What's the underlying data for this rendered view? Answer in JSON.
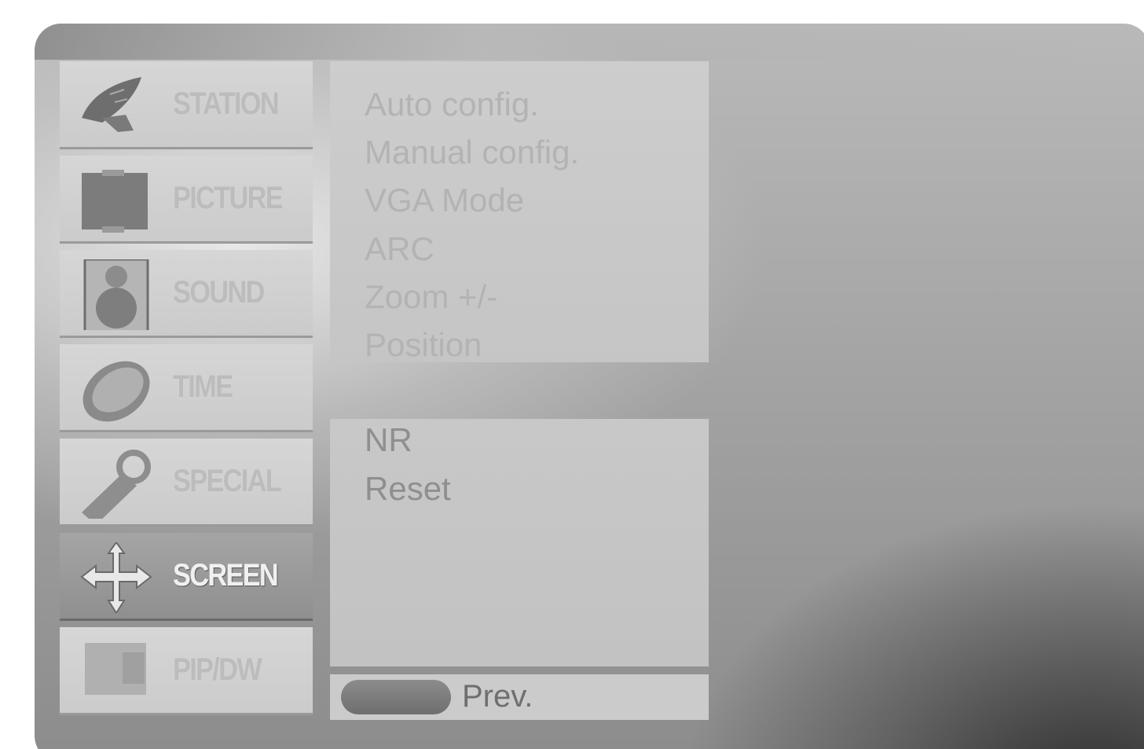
{
  "menu": {
    "items": [
      {
        "label": "STATION",
        "icon": "satellite-dish-icon",
        "active": false
      },
      {
        "label": "PICTURE",
        "icon": "picture-screen-icon",
        "active": false
      },
      {
        "label": "SOUND",
        "icon": "speaker-icon",
        "active": false
      },
      {
        "label": "TIME",
        "icon": "clock-disc-icon",
        "active": false
      },
      {
        "label": "SPECIAL",
        "icon": "key-tag-icon",
        "active": false
      },
      {
        "label": "SCREEN",
        "icon": "move-arrows-icon",
        "active": true
      },
      {
        "label": "PIP/DW",
        "icon": "pip-icon",
        "active": false
      }
    ]
  },
  "submenu": {
    "top_options": [
      "Auto config.",
      "Manual config.",
      "VGA Mode",
      "ARC",
      "Zoom +/-",
      "Position"
    ],
    "bottom_options": [
      "NR",
      "Reset"
    ]
  },
  "nav": {
    "prev_label": "Prev."
  }
}
